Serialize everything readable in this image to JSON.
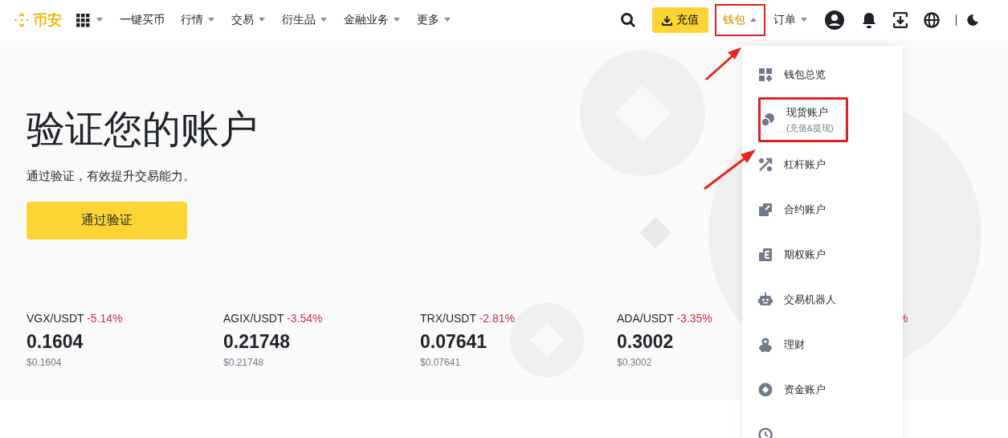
{
  "header": {
    "logo": "币安",
    "nav": [
      {
        "label": "一键买币",
        "caret": false
      },
      {
        "label": "行情",
        "caret": true
      },
      {
        "label": "交易",
        "caret": true
      },
      {
        "label": "衍生品",
        "caret": true
      },
      {
        "label": "金融业务",
        "caret": true
      },
      {
        "label": "更多",
        "caret": true
      }
    ],
    "deposit_button": "充值",
    "wallet": {
      "label": "钱包",
      "expanded": true,
      "annotated": true
    },
    "orders": {
      "label": "订单",
      "caret": true
    }
  },
  "hero": {
    "title": "验证您的账户",
    "subtitle": "通过验证，有效提升交易能力。",
    "button": "通过验证"
  },
  "tickers": [
    {
      "pair": "VGX/USDT",
      "change": "-5.14%",
      "price": "0.1604",
      "usd": "$0.1604"
    },
    {
      "pair": "AGIX/USDT",
      "change": "-3.54%",
      "price": "0.21748",
      "usd": "$0.21748"
    },
    {
      "pair": "TRX/USDT",
      "change": "-2.81%",
      "price": "0.07641",
      "usd": "$0.07641"
    },
    {
      "pair": "ADA/USDT",
      "change": "-3.35%",
      "price": "0.3002",
      "usd": "$0.3002"
    }
  ],
  "partial_ticker_change": "%",
  "wallet_menu": [
    {
      "kind": "overview",
      "label": "钱包总览",
      "annotated": false
    },
    {
      "kind": "spot",
      "label": "现货账户",
      "sublabel": "(充值&提现)",
      "annotated": true
    },
    {
      "kind": "margin",
      "label": "杠杆账户",
      "annotated": false
    },
    {
      "kind": "futures",
      "label": "合约账户",
      "annotated": false
    },
    {
      "kind": "options",
      "label": "期权账户",
      "annotated": false
    },
    {
      "kind": "bot",
      "label": "交易机器人",
      "annotated": false
    },
    {
      "kind": "earn",
      "label": "理财",
      "annotated": false
    },
    {
      "kind": "funding",
      "label": "资金账户",
      "annotated": false
    },
    {
      "kind": "history",
      "annotated": false
    }
  ]
}
